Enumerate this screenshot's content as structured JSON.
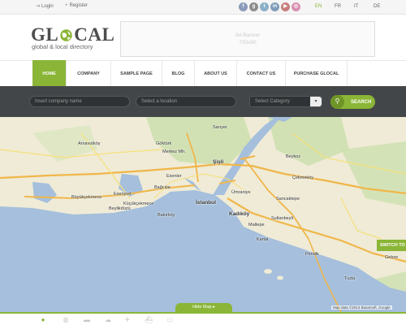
{
  "topbar": {
    "login_label": "Login",
    "register_label": "Register",
    "socials": [
      {
        "icon": "facebook-icon",
        "glyph": "f",
        "color": "#8a9ab9"
      },
      {
        "icon": "google-plus-icon",
        "glyph": "g",
        "color": "#8c8c8c"
      },
      {
        "icon": "twitter-icon",
        "glyph": "t",
        "color": "#8ab0c8"
      },
      {
        "icon": "linkedin-icon",
        "glyph": "in",
        "color": "#7f9db8"
      },
      {
        "icon": "youtube-icon",
        "glyph": "▶",
        "color": "#c87d7d"
      },
      {
        "icon": "dribbble-icon",
        "glyph": "◎",
        "color": "#d890b0"
      }
    ],
    "languages": [
      "EN",
      "FR",
      "IT",
      "DE"
    ],
    "active_language": "EN"
  },
  "header": {
    "logo_left": "GL",
    "logo_right": "CAL",
    "tagline": "global & local directory",
    "ad_line1": "Ad Banner",
    "ad_line2": "720x90"
  },
  "nav": {
    "items": [
      "HOME",
      "COMPANY",
      "SAMPLE PAGE",
      "BLOG",
      "ABOUT US",
      "CONTACT US",
      "PURCHASE GLOCAL"
    ],
    "active": "HOME"
  },
  "search": {
    "company_placeholder": "Insert company name",
    "location_placeholder": "Select a location",
    "category_placeholder": "Select Category",
    "button_label": "SEARCH"
  },
  "map": {
    "labels": [
      "Göktürk",
      "Merkez Mh.",
      "Şişli",
      "Beykoz",
      "Esenler",
      "Bağcılar",
      "İstanbul",
      "Ümraniye",
      "Esenyurt",
      "Küçükçekmece",
      "Büyükçekmece",
      "Beylikdüzü",
      "Bakırköy",
      "Kadıköy",
      "Maltepe",
      "Sancaktepe",
      "Sultanbeyli",
      "Kartal",
      "Pendik",
      "Tuzla",
      "Gebze",
      "Çekmeköy",
      "Sarıyer",
      "Arnavutköy"
    ],
    "switch_label": "SWITCH TO",
    "hide_label": "Hide Map ▸",
    "attribution": "Map data ©2013 Basarsoft, Google"
  },
  "colors": {
    "accent": "#8ab536",
    "dark_bar": "#434648",
    "water": "#a5bfdd",
    "land": "#efebd6",
    "park": "#c9dfaa"
  },
  "bottom_icons": [
    "pin-icon",
    "globe-icon",
    "car-icon",
    "cloud-icon",
    "plane-icon",
    "ship-icon",
    "bed-icon"
  ]
}
